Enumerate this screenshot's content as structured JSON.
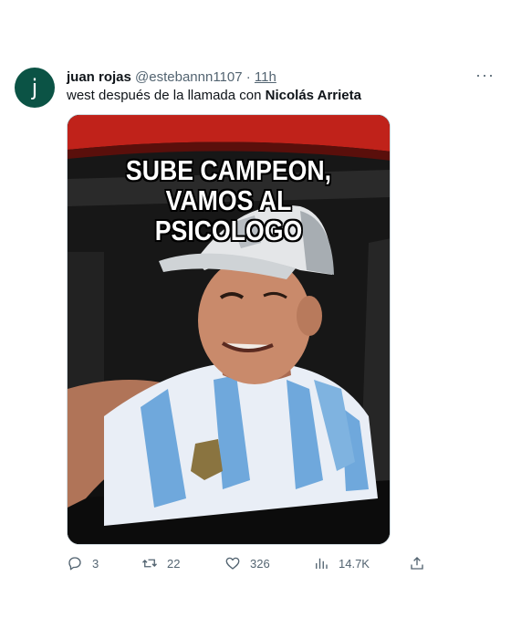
{
  "tweet": {
    "avatar_letter": "j",
    "display_name": "juan rojas",
    "handle": "@estebannn1107",
    "separator": "·",
    "time": "11h",
    "text_before": "west después de la llamada con ",
    "mention": "Nicolás Arrieta",
    "more_label": "···"
  },
  "media": {
    "caption_line1": "SUBE CAMPEON, VAMOS AL",
    "caption_line2": "PSICOLOGO"
  },
  "actions": {
    "replies": "3",
    "retweets": "22",
    "likes": "326",
    "views": "14.7K"
  },
  "colors": {
    "avatar_bg": "#0b5345",
    "muted": "#536471",
    "text": "#0f1419"
  }
}
